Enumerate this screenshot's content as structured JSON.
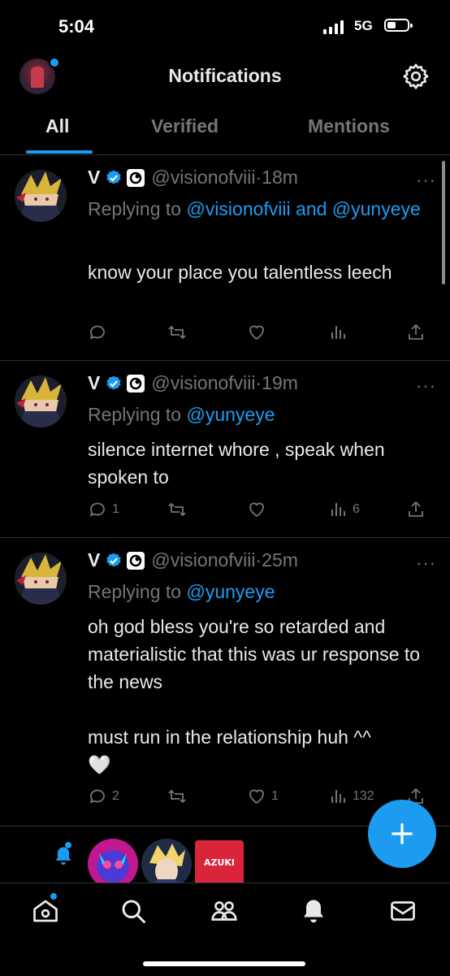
{
  "status_bar": {
    "time": "5:04",
    "network": "5G"
  },
  "header": {
    "title": "Notifications"
  },
  "tabs": [
    {
      "label": "All",
      "active": true
    },
    {
      "label": "Verified",
      "active": false
    },
    {
      "label": "Mentions",
      "active": false
    }
  ],
  "tweets": [
    {
      "name": "V",
      "handle": "@visionofviii",
      "time": "·18m",
      "reply_prefix": "Replying to ",
      "reply_mentions": "@visionofviii and @yunyeye",
      "text": "know your place you talentless leech",
      "replies": "",
      "retweets": "",
      "likes": "",
      "views": ""
    },
    {
      "name": "V",
      "handle": "@visionofviii",
      "time": "·19m",
      "reply_prefix": "Replying to ",
      "reply_mentions": "@yunyeye",
      "text": "silence internet whore , speak when spoken to",
      "replies": "1",
      "retweets": "",
      "likes": "",
      "views": "6"
    },
    {
      "name": "V",
      "handle": "@visionofviii",
      "time": "·25m",
      "reply_prefix": "Replying to ",
      "reply_mentions": "@yunyeye",
      "text": "oh god bless you're so retarded and materialistic that this was ur response to the news\n\nmust run in the relationship huh ^^\n🤍",
      "replies": "2",
      "retweets": "",
      "likes": "1",
      "views": "132"
    }
  ],
  "spaces": {
    "azuki_label": "AZUKI"
  },
  "colors": {
    "accent": "#1d9bf0",
    "muted": "#71767b",
    "text": "#e7e9ea",
    "background": "#000000",
    "divider": "#2f3336"
  },
  "icons": {
    "header": [
      "gear-icon"
    ],
    "tweet_actions": [
      "reply-icon",
      "retweet-icon",
      "like-icon",
      "views-icon",
      "share-icon"
    ],
    "fab": "plus-icon",
    "bottom_nav": [
      "home-icon",
      "search-icon",
      "communities-icon",
      "notifications-icon",
      "messages-icon"
    ]
  }
}
